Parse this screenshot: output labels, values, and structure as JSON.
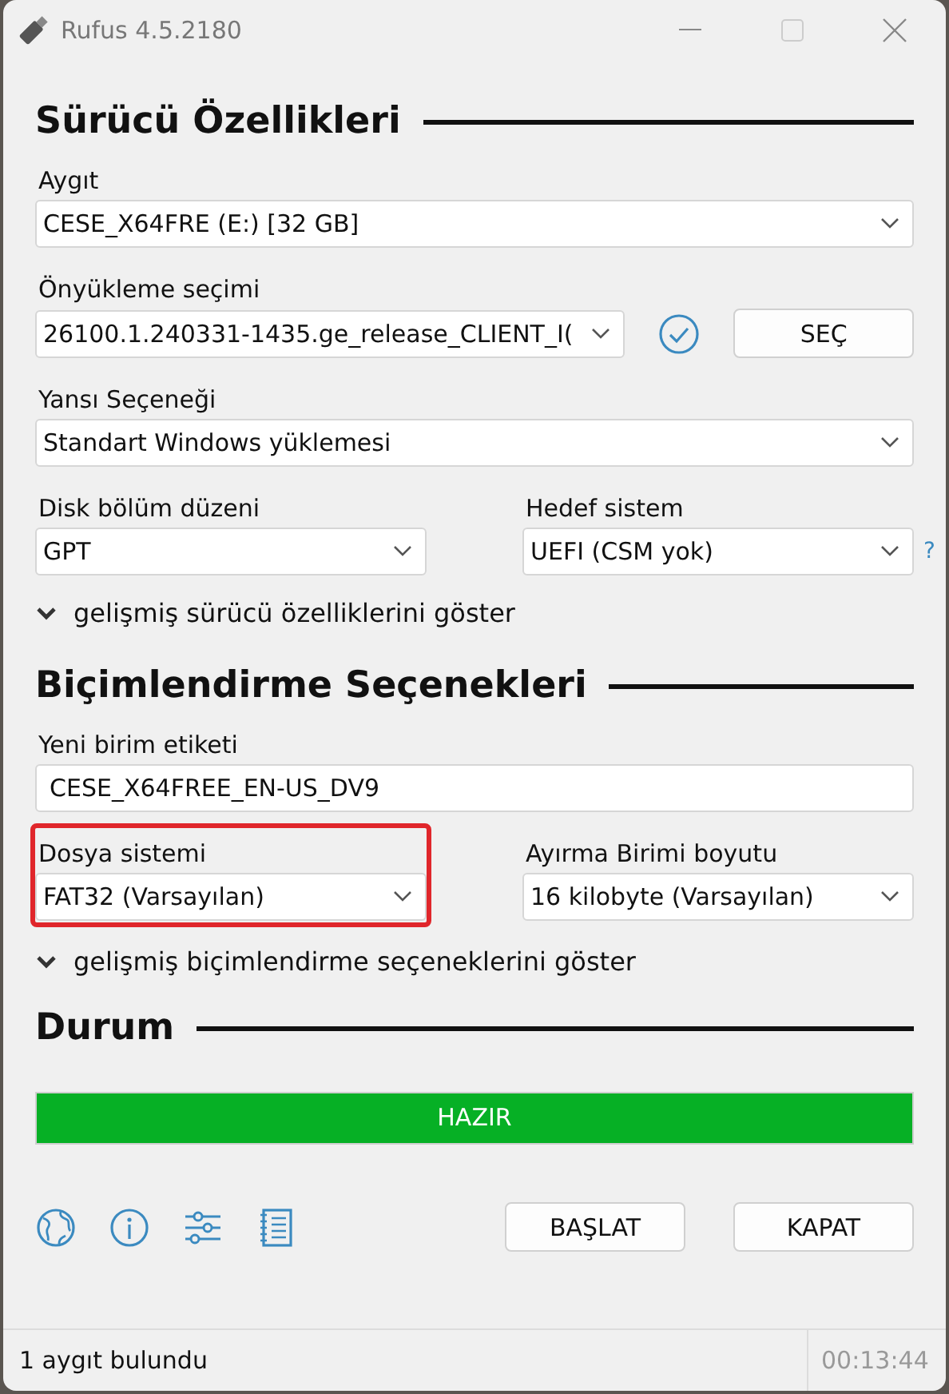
{
  "window": {
    "title": "Rufus 4.5.2180"
  },
  "drive_section": {
    "heading": "Sürücü Özellikleri",
    "device": {
      "label": "Aygıt",
      "value": "CESE_X64FRE (E:) [32 GB]"
    },
    "boot_selection": {
      "label": "Önyükleme seçimi",
      "value": "26100.1.240331-1435.ge_release_CLIENT_I(",
      "verified": true,
      "button": "SEÇ"
    },
    "image_option": {
      "label": "Yansı Seçeneği",
      "value": "Standart Windows yüklemesi"
    },
    "partition_scheme": {
      "label": "Disk bölüm düzeni",
      "value": "GPT"
    },
    "target_system": {
      "label": "Hedef sistem",
      "value": "UEFI (CSM yok)",
      "help": "?"
    },
    "advanced": {
      "label": "gelişmiş sürücü özelliklerini göster",
      "expanded": false
    }
  },
  "format_section": {
    "heading": "Biçimlendirme Seçenekleri",
    "volume_label": {
      "label": "Yeni birim etiketi",
      "value": "CESE_X64FREE_EN-US_DV9"
    },
    "file_system": {
      "label": "Dosya sistemi",
      "value": "FAT32 (Varsayılan)",
      "highlighted": true
    },
    "cluster_size": {
      "label": "Ayırma Birimi boyutu",
      "value": "16 kilobyte (Varsayılan)",
      "highlighted": false
    },
    "advanced": {
      "label": "gelişmiş biçimlendirme seçeneklerini göster",
      "expanded": false
    }
  },
  "status_section": {
    "heading": "Durum",
    "progress": {
      "label": "HAZIR",
      "level": 1
    }
  },
  "buttons": [
    "BAŞLAT",
    "KAPAT"
  ],
  "status_bar": {
    "message": "1 aygıt bulundu",
    "time": "00:13:44"
  }
}
